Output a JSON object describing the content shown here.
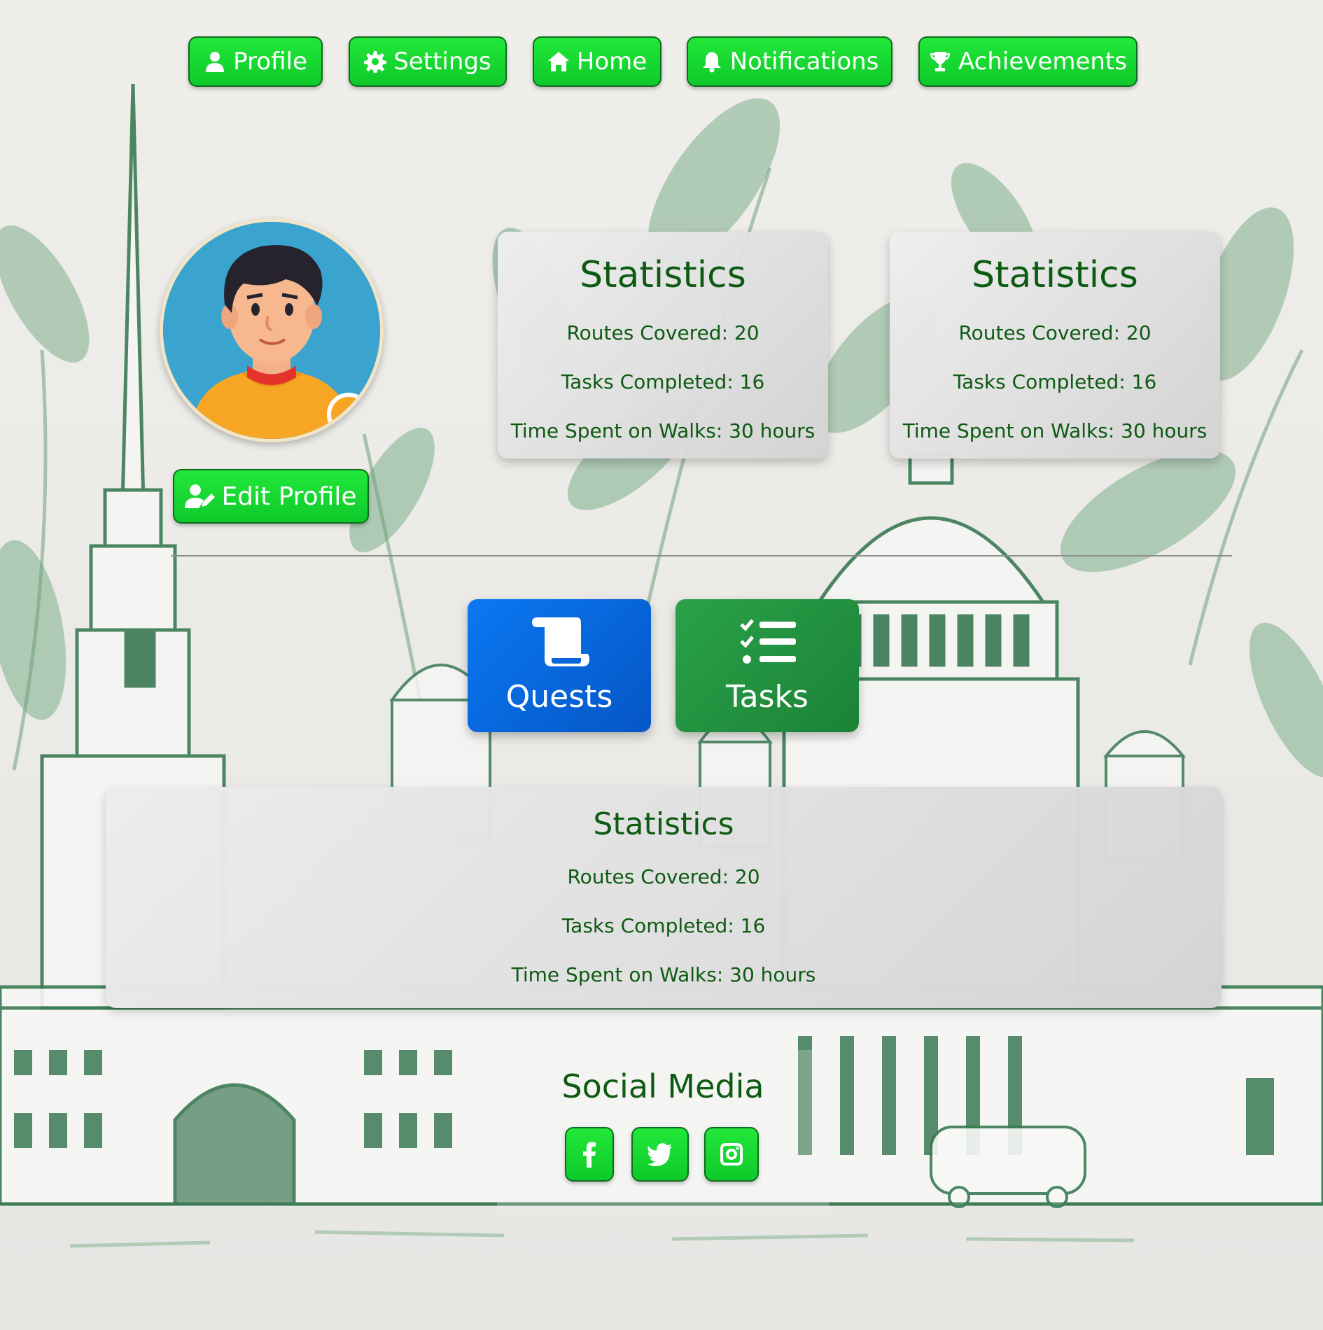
{
  "nav": {
    "profile": "Profile",
    "settings": "Settings",
    "home": "Home",
    "notifications": "Notifications",
    "achievements": "Achievements"
  },
  "profile": {
    "edit_label": "Edit Profile"
  },
  "stats_cards": [
    {
      "title": "Statistics",
      "routes": "Routes Covered: 20",
      "tasks": "Tasks Completed: 16",
      "time": "Time Spent on Walks: 30 hours"
    },
    {
      "title": "Statistics",
      "routes": "Routes Covered: 20",
      "tasks": "Tasks Completed: 16",
      "time": "Time Spent on Walks: 30 hours"
    }
  ],
  "tiles": {
    "quests": "Quests",
    "tasks": "Tasks"
  },
  "wide_stats": {
    "title": "Statistics",
    "routes": "Routes Covered: 20",
    "tasks": "Tasks Completed: 16",
    "time": "Time Spent on Walks: 30 hours"
  },
  "social": {
    "title": "Social Media",
    "icons": [
      "facebook-icon",
      "twitter-icon",
      "instagram-icon"
    ]
  },
  "colors": {
    "nav_green": "#0ec92a",
    "text_green": "#0d5a12",
    "quests_blue": "#0a78f2",
    "tasks_green": "#1f8a3a"
  }
}
